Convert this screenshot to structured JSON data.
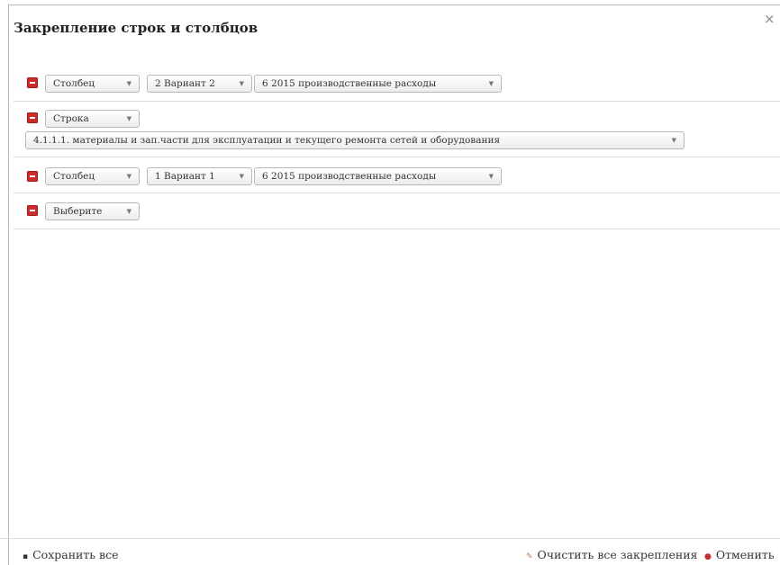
{
  "dialog": {
    "title": "Закрепление строк и столбцов",
    "close_icon": "×"
  },
  "rows": [
    {
      "type": "Столбец",
      "variant": "2 Вариант 2",
      "item": "6 2015 производственные расходы"
    },
    {
      "type": "Строка",
      "item": "4.1.1.1. материалы и зап.части для эксплуатации и текущего ремонта сетей и оборудования"
    },
    {
      "type": "Столбец",
      "variant": "1 Вариант 1",
      "item": "6 2015 производственные расходы"
    },
    {
      "type": "Выберите"
    }
  ],
  "footer": {
    "save_icon": "▪",
    "save_label": "Сохранить все",
    "clear_icon": "✎",
    "clear_label": "Очистить все закрепления",
    "cancel_icon": "●",
    "cancel_label": "Отменить"
  },
  "colors": {
    "delete": "#cf2b2b",
    "title": "#222222"
  }
}
